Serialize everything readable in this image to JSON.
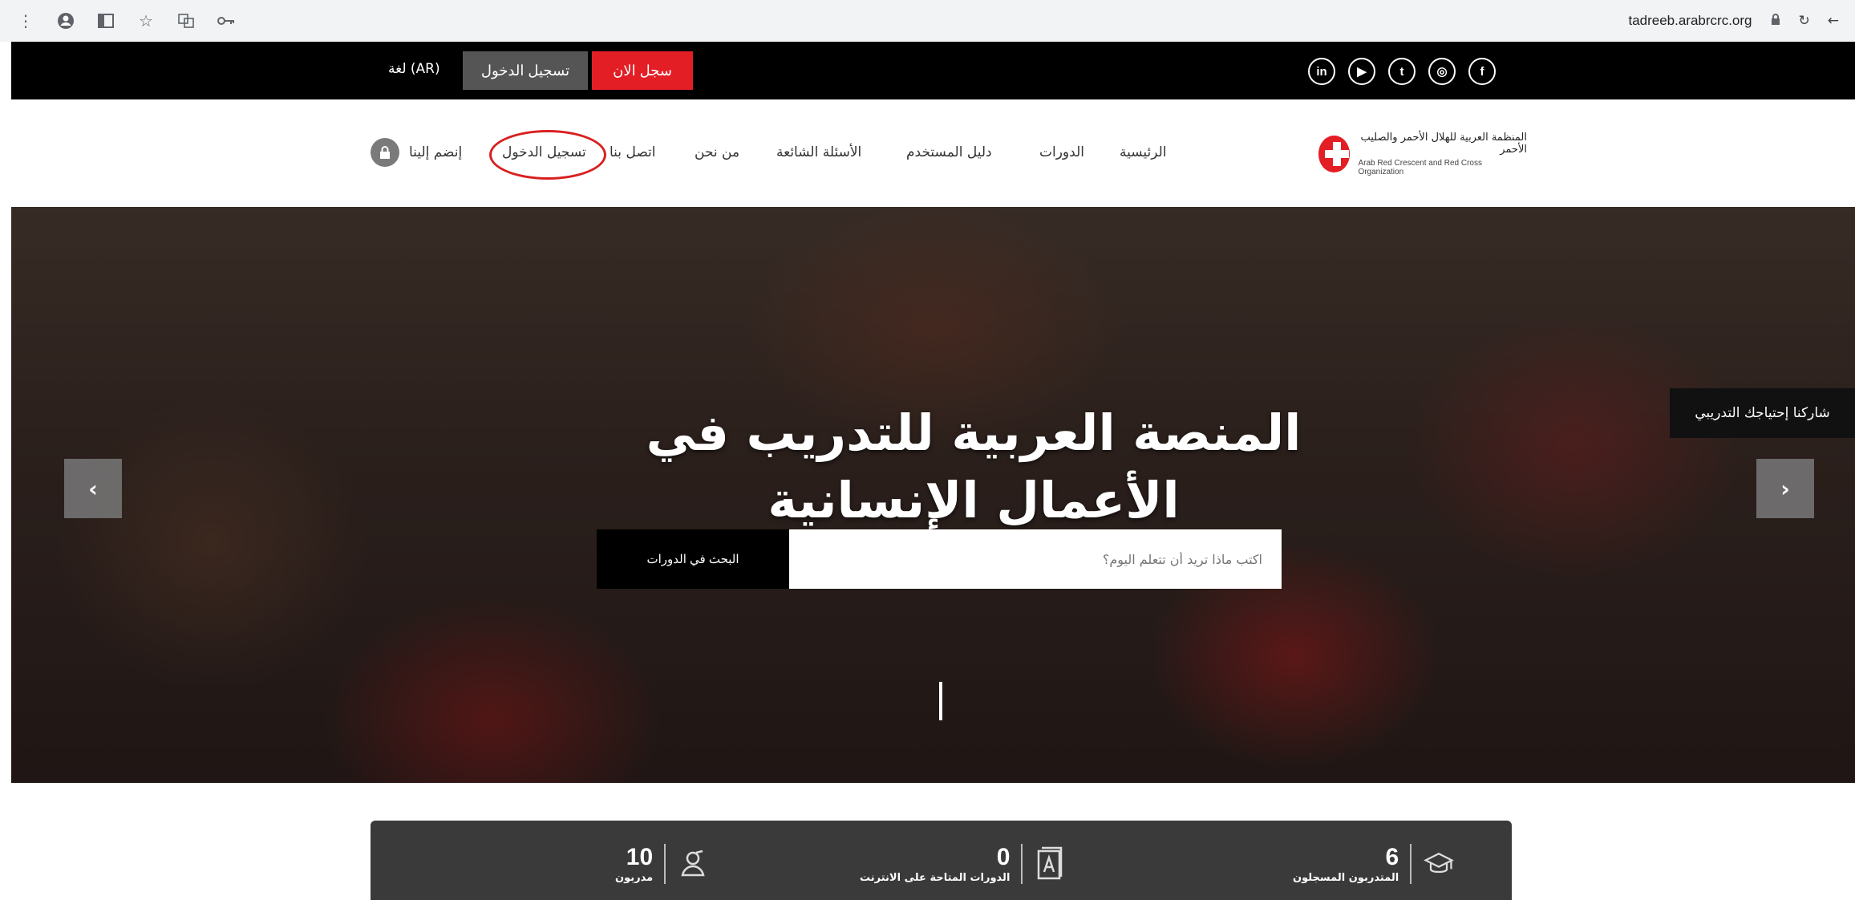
{
  "browser": {
    "url": "tadreeb.arabrcrc.org"
  },
  "topbar": {
    "language_label": "لغة (AR)",
    "login_button": "تسجيل الدخول",
    "signup_button": "سجل الان",
    "socials": [
      "linkedin-icon",
      "youtube-icon",
      "twitter-icon",
      "instagram-icon",
      "facebook-icon"
    ],
    "social_glyphs": [
      "in",
      "▶",
      "t",
      "◎",
      "f"
    ]
  },
  "nav": {
    "logo_ar": "المنظمة العربية للهلال الأحمر والصليب الأحمر",
    "logo_en": "Arab Red Crescent and Red Cross Organization",
    "items": {
      "home": "الرئيسية",
      "courses": "الدورات",
      "user_guide": "دليل المستخدم",
      "faq": "الأسئلة الشائعة",
      "about": "من نحن",
      "contact": "اتصل بنا",
      "login": "تسجيل الدخول",
      "join": "إنضم إلينا"
    }
  },
  "hero": {
    "title_line1": "المنصة العربية للتدريب في",
    "title_line2": "الأعمال الإنسانية",
    "search_placeholder": "اكتب ماذا تريد أن تتعلم اليوم؟",
    "search_button": "البحث في الدورات",
    "share_button": "شاركنا إحتياجك التدريبي",
    "prev_arrow": "‹",
    "next_arrow": "›"
  },
  "stats": {
    "trainers": {
      "value": "10",
      "label": "مدربون"
    },
    "online_courses": {
      "value": "0",
      "label": "الدورات المتاحة على الانترنت"
    },
    "registered_trainees": {
      "value": "6",
      "label": "المتدربون المسجلون"
    }
  },
  "colors": {
    "brand_red": "#e31e24",
    "topbar": "#000000",
    "annotation_circle": "#d8201f"
  }
}
